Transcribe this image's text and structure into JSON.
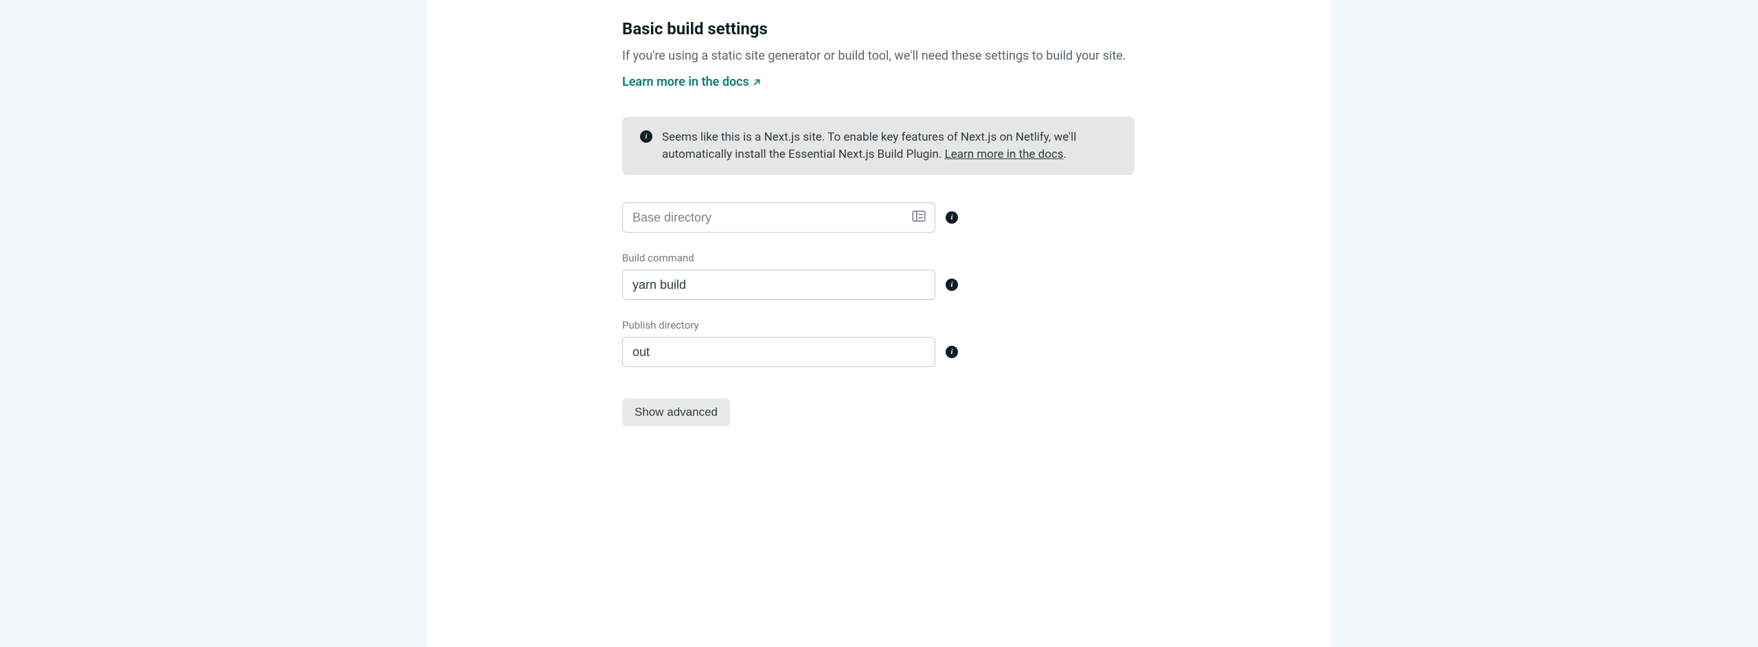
{
  "section": {
    "title": "Basic build settings",
    "subtitle": "If you're using a static site generator or build tool, we'll need these settings to build your site.",
    "learn_more_label": "Learn more in the docs"
  },
  "info_notice": {
    "text_before": "Seems like this is a Next.js site. To enable key features of Next.js on Netlify, we'll automatically install the Essential Next.js Build Plugin. ",
    "link_text": "Learn more in the docs",
    "text_after": "."
  },
  "fields": {
    "base_directory": {
      "placeholder": "Base directory",
      "value": ""
    },
    "build_command": {
      "label": "Build command",
      "value": "yarn build"
    },
    "publish_directory": {
      "label": "Publish directory",
      "value": "out"
    }
  },
  "buttons": {
    "show_advanced": "Show advanced"
  }
}
